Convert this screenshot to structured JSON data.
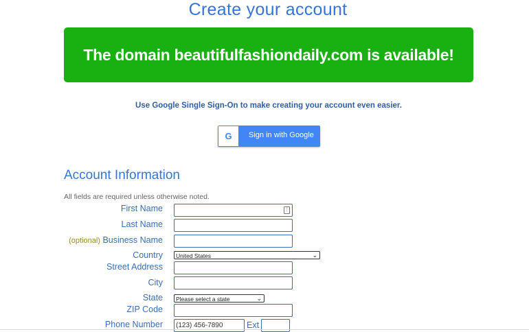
{
  "page_title": "Create your account",
  "banner_text": "The domain beautifulfashiondaily.com is available!",
  "sso_note": "Use Google Single Sign-On to make creating your account even easier.",
  "google_button": {
    "icon_letter": "G",
    "label": "Sign in with Google"
  },
  "section_title": "Account Information",
  "required_note": "All fields are required unless otherwise noted.",
  "fields": {
    "first_name": "First Name",
    "last_name": "Last Name",
    "optional_tag": "(optional)",
    "business_name": "Business Name",
    "country": "Country",
    "country_value": "United States",
    "street_address": "Street Address",
    "city": "City",
    "state": "State",
    "state_value": "Please select a state",
    "zip": "ZIP Code",
    "phone": "Phone Number",
    "phone_placeholder": "(123) 456-7890",
    "ext": "Ext"
  },
  "colors": {
    "banner": "#19b012",
    "accent": "#3575d3",
    "google": "#4285f4"
  }
}
